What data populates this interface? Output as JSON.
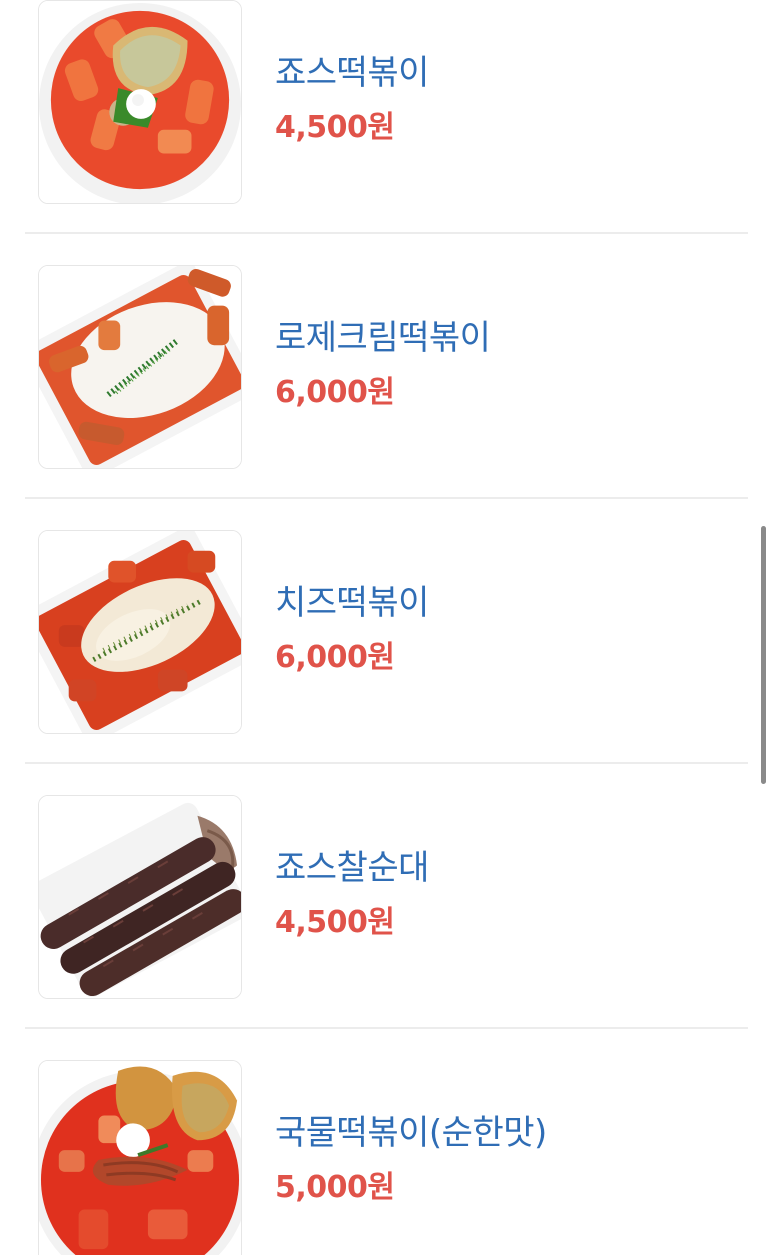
{
  "menu": {
    "items": [
      {
        "name": "죠스떡볶이",
        "price": "4,500원",
        "image": "tteokbokki-bowl-image"
      },
      {
        "name": "로제크림떡볶이",
        "price": "6,000원",
        "image": "rose-cream-tteokbokki-image"
      },
      {
        "name": "치즈떡볶이",
        "price": "6,000원",
        "image": "cheese-tteokbokki-image"
      },
      {
        "name": "죠스찰순대",
        "price": "4,500원",
        "image": "sundae-image"
      },
      {
        "name": "국물떡볶이(순한맛)",
        "price": "5,000원",
        "image": "soup-tteokbokki-image"
      }
    ]
  },
  "colors": {
    "name": "#2f6db5",
    "price": "#e0534a",
    "divider": "#ececec",
    "scrollbar": "#8a8a8a"
  }
}
